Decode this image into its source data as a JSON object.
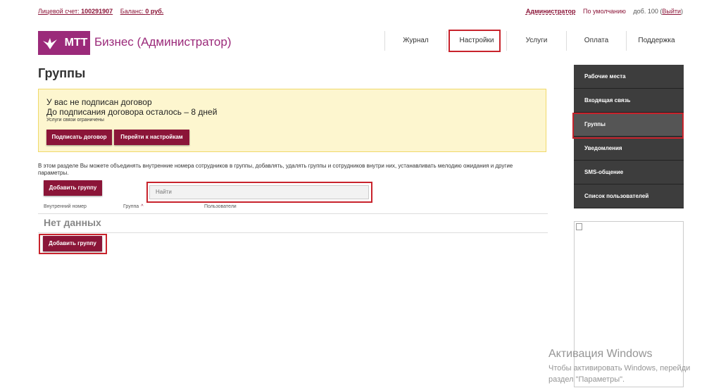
{
  "top": {
    "account_label": "Лицевой счет: ",
    "account_number": "100291907",
    "balance_label": "Баланс: ",
    "balance_value": "0 руб.",
    "admin": "Администратор",
    "default_label": "По умолчанию",
    "ext": "доб. 100 (",
    "logout": "Выйти",
    "ext_close": ")"
  },
  "brand": {
    "mtt": "МТТ",
    "title": "Бизнес (Администратор)",
    "color": "#9b2a7a"
  },
  "nav": [
    {
      "label": "Журнал"
    },
    {
      "label": "Настройки"
    },
    {
      "label": "Услуги"
    },
    {
      "label": "Оплата"
    },
    {
      "label": "Поддержка"
    }
  ],
  "page_title": "Группы",
  "warning": {
    "line1": "У вас не подписан договор",
    "line2": "До подписания договора осталось – 8 дней",
    "line3": "Услуги связи ограничены",
    "sign_button": "Подписать договор",
    "settings_button": "Перейти к настройкам"
  },
  "description": "В этом разделе Вы можете объединять внутренние номера сотрудников в группы, добавлять, удалять группы и сотрудников внутри них, устанавливать мелодию ожидания и другие параметры.",
  "add_group_button": "Добавить группу",
  "search": {
    "placeholder": "Найти"
  },
  "table": {
    "columns": [
      "Внутренний номер",
      "Группа",
      "Пользователи"
    ],
    "sort_indicator": "^",
    "empty": "Нет данных"
  },
  "sidebar": [
    {
      "label": "Рабочие места"
    },
    {
      "label": "Входящая связь"
    },
    {
      "label": "Группы"
    },
    {
      "label": "Уведомления"
    },
    {
      "label": "SMS-общение"
    },
    {
      "label": "Список пользователей"
    }
  ],
  "watermark": {
    "line1": "Активация Windows",
    "line2": "Чтобы активировать Windows, перейди",
    "line3": "раздел \"Параметры\"."
  },
  "colors": {
    "accent": "#8b1538",
    "highlight": "#c8232c",
    "sidebar": "#3d3d3d"
  }
}
